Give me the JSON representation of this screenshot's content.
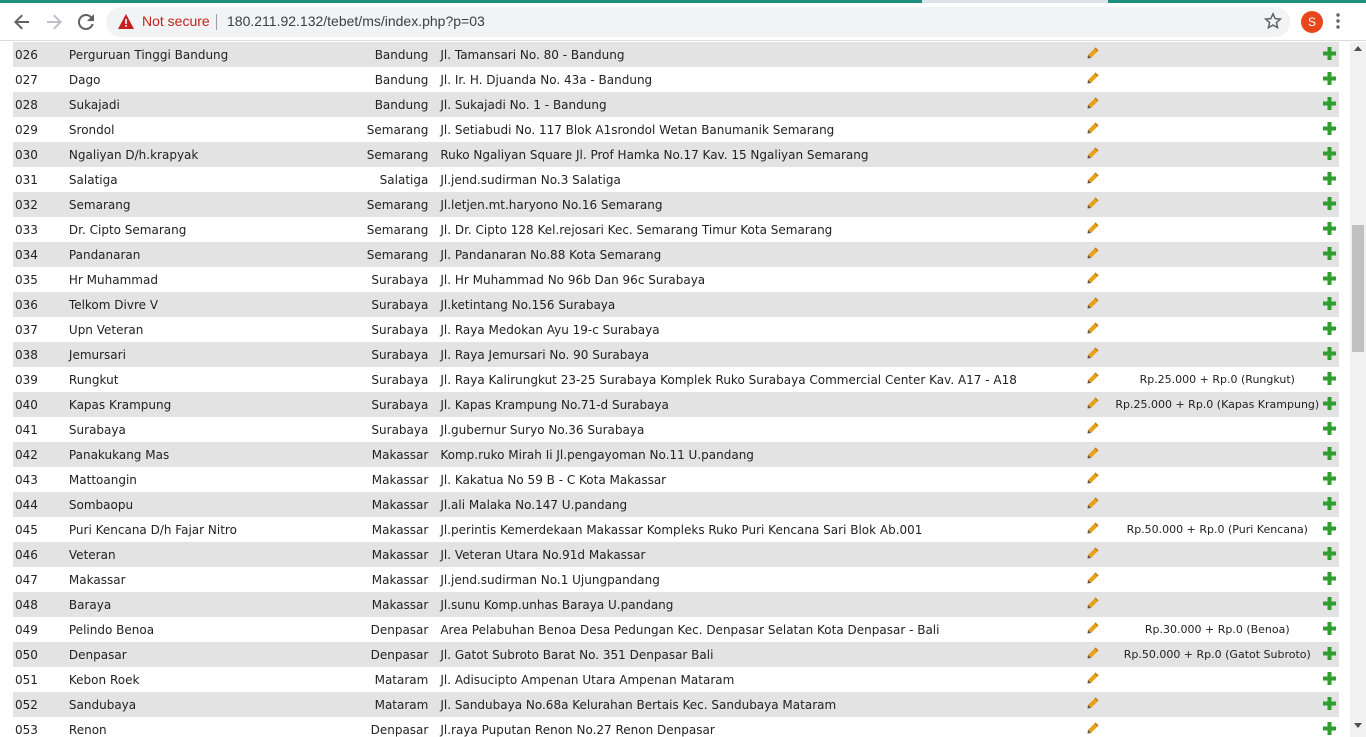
{
  "browser": {
    "security_label": "Not secure",
    "url": "180.211.92.132/tebet/ms/index.php?p=03",
    "profile_initial": "S"
  },
  "colors": {
    "row_alt": "#e3e3e3",
    "edit_icon": "#e8a21a",
    "add_icon": "#2e9e2e",
    "accent_tab": "#1e8f7d"
  },
  "rows": [
    {
      "code": "026",
      "name": "Perguruan Tinggi Bandung",
      "city": "Bandung",
      "address": "Jl. Tamansari No. 80 - Bandung",
      "fee": ""
    },
    {
      "code": "027",
      "name": "Dago",
      "city": "Bandung",
      "address": "Jl. Ir. H. Djuanda No. 43a - Bandung",
      "fee": ""
    },
    {
      "code": "028",
      "name": "Sukajadi",
      "city": "Bandung",
      "address": "Jl. Sukajadi No. 1 - Bandung",
      "fee": ""
    },
    {
      "code": "029",
      "name": "Srondol",
      "city": "Semarang",
      "address": "Jl. Setiabudi No. 117 Blok A1srondol Wetan Banumanik Semarang",
      "fee": ""
    },
    {
      "code": "030",
      "name": "Ngaliyan D/h.krapyak",
      "city": "Semarang",
      "address": "Ruko Ngaliyan Square Jl. Prof Hamka No.17 Kav. 15 Ngaliyan Semarang",
      "fee": ""
    },
    {
      "code": "031",
      "name": "Salatiga",
      "city": "Salatiga",
      "address": "Jl.jend.sudirman No.3 Salatiga",
      "fee": ""
    },
    {
      "code": "032",
      "name": "Semarang",
      "city": "Semarang",
      "address": "Jl.letjen.mt.haryono No.16 Semarang",
      "fee": ""
    },
    {
      "code": "033",
      "name": "Dr. Cipto Semarang",
      "city": "Semarang",
      "address": "Jl. Dr. Cipto 128 Kel.rejosari Kec. Semarang Timur Kota Semarang",
      "fee": ""
    },
    {
      "code": "034",
      "name": "Pandanaran",
      "city": "Semarang",
      "address": "Jl. Pandanaran No.88 Kota Semarang",
      "fee": ""
    },
    {
      "code": "035",
      "name": "Hr Muhammad",
      "city": "Surabaya",
      "address": "Jl. Hr Muhammad No 96b Dan 96c Surabaya",
      "fee": ""
    },
    {
      "code": "036",
      "name": "Telkom Divre V",
      "city": "Surabaya",
      "address": "Jl.ketintang No.156 Surabaya",
      "fee": ""
    },
    {
      "code": "037",
      "name": "Upn Veteran",
      "city": "Surabaya",
      "address": "Jl. Raya Medokan Ayu 19-c Surabaya",
      "fee": ""
    },
    {
      "code": "038",
      "name": "Jemursari",
      "city": "Surabaya",
      "address": "Jl. Raya Jemursari No. 90 Surabaya",
      "fee": ""
    },
    {
      "code": "039",
      "name": "Rungkut",
      "city": "Surabaya",
      "address": "Jl. Raya Kalirungkut 23-25 Surabaya Komplek Ruko Surabaya Commercial Center Kav. A17 - A18",
      "fee": "Rp.25.000 + Rp.0 (Rungkut)"
    },
    {
      "code": "040",
      "name": "Kapas Krampung",
      "city": "Surabaya",
      "address": "Jl. Kapas Krampung No.71-d Surabaya",
      "fee": "Rp.25.000 + Rp.0 (Kapas Krampung)"
    },
    {
      "code": "041",
      "name": "Surabaya",
      "city": "Surabaya",
      "address": "Jl.gubernur Suryo No.36 Surabaya",
      "fee": ""
    },
    {
      "code": "042",
      "name": "Panakukang Mas",
      "city": "Makassar",
      "address": "Komp.ruko Mirah Ii Jl.pengayoman No.11 U.pandang",
      "fee": ""
    },
    {
      "code": "043",
      "name": "Mattoangin",
      "city": "Makassar",
      "address": "Jl. Kakatua No 59 B - C Kota Makassar",
      "fee": ""
    },
    {
      "code": "044",
      "name": "Sombaopu",
      "city": "Makassar",
      "address": "Jl.ali Malaka No.147 U.pandang",
      "fee": ""
    },
    {
      "code": "045",
      "name": "Puri Kencana D/h Fajar Nitro",
      "city": "Makassar",
      "address": "Jl.perintis Kemerdekaan Makassar Kompleks Ruko Puri Kencana Sari Blok Ab.001",
      "fee": "Rp.50.000 + Rp.0 (Puri Kencana)"
    },
    {
      "code": "046",
      "name": "Veteran",
      "city": "Makassar",
      "address": "Jl. Veteran Utara No.91d Makassar",
      "fee": ""
    },
    {
      "code": "047",
      "name": "Makassar",
      "city": "Makassar",
      "address": "Jl.jend.sudirman No.1 Ujungpandang",
      "fee": ""
    },
    {
      "code": "048",
      "name": "Baraya",
      "city": "Makassar",
      "address": "Jl.sunu Komp.unhas Baraya U.pandang",
      "fee": ""
    },
    {
      "code": "049",
      "name": "Pelindo Benoa",
      "city": "Denpasar",
      "address": "Area Pelabuhan Benoa Desa Pedungan Kec. Denpasar Selatan Kota Denpasar - Bali",
      "fee": "Rp.30.000 + Rp.0 (Benoa)"
    },
    {
      "code": "050",
      "name": "Denpasar",
      "city": "Denpasar",
      "address": "Jl. Gatot Subroto Barat No. 351 Denpasar Bali",
      "fee": "Rp.50.000 + Rp.0 (Gatot Subroto)"
    },
    {
      "code": "051",
      "name": "Kebon Roek",
      "city": "Mataram",
      "address": "Jl. Adisucipto Ampenan Utara Ampenan Mataram",
      "fee": ""
    },
    {
      "code": "052",
      "name": "Sandubaya",
      "city": "Mataram",
      "address": "Jl. Sandubaya No.68a Kelurahan Bertais Kec. Sandubaya Mataram",
      "fee": ""
    },
    {
      "code": "053",
      "name": "Renon",
      "city": "Denpasar",
      "address": "Jl.raya Puputan Renon No.27 Renon Denpasar",
      "fee": ""
    }
  ]
}
